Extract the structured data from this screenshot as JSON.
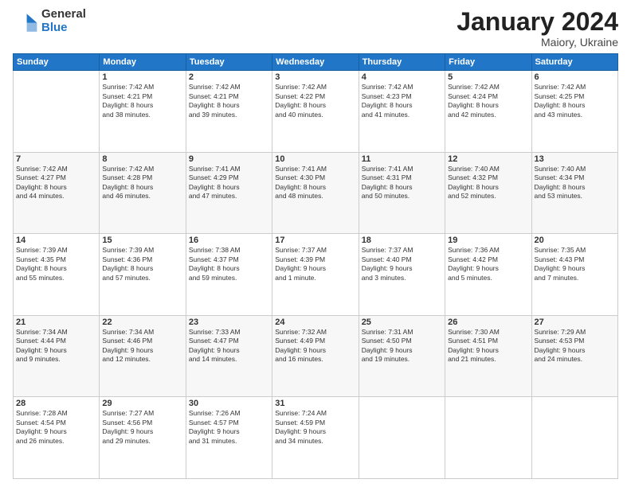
{
  "header": {
    "logo_general": "General",
    "logo_blue": "Blue",
    "month_title": "January 2024",
    "location": "Maiory, Ukraine"
  },
  "weekdays": [
    "Sunday",
    "Monday",
    "Tuesday",
    "Wednesday",
    "Thursday",
    "Friday",
    "Saturday"
  ],
  "weeks": [
    [
      {
        "day": "",
        "info": ""
      },
      {
        "day": "1",
        "info": "Sunrise: 7:42 AM\nSunset: 4:21 PM\nDaylight: 8 hours\nand 38 minutes."
      },
      {
        "day": "2",
        "info": "Sunrise: 7:42 AM\nSunset: 4:21 PM\nDaylight: 8 hours\nand 39 minutes."
      },
      {
        "day": "3",
        "info": "Sunrise: 7:42 AM\nSunset: 4:22 PM\nDaylight: 8 hours\nand 40 minutes."
      },
      {
        "day": "4",
        "info": "Sunrise: 7:42 AM\nSunset: 4:23 PM\nDaylight: 8 hours\nand 41 minutes."
      },
      {
        "day": "5",
        "info": "Sunrise: 7:42 AM\nSunset: 4:24 PM\nDaylight: 8 hours\nand 42 minutes."
      },
      {
        "day": "6",
        "info": "Sunrise: 7:42 AM\nSunset: 4:25 PM\nDaylight: 8 hours\nand 43 minutes."
      }
    ],
    [
      {
        "day": "7",
        "info": "Sunrise: 7:42 AM\nSunset: 4:27 PM\nDaylight: 8 hours\nand 44 minutes."
      },
      {
        "day": "8",
        "info": "Sunrise: 7:42 AM\nSunset: 4:28 PM\nDaylight: 8 hours\nand 46 minutes."
      },
      {
        "day": "9",
        "info": "Sunrise: 7:41 AM\nSunset: 4:29 PM\nDaylight: 8 hours\nand 47 minutes."
      },
      {
        "day": "10",
        "info": "Sunrise: 7:41 AM\nSunset: 4:30 PM\nDaylight: 8 hours\nand 48 minutes."
      },
      {
        "day": "11",
        "info": "Sunrise: 7:41 AM\nSunset: 4:31 PM\nDaylight: 8 hours\nand 50 minutes."
      },
      {
        "day": "12",
        "info": "Sunrise: 7:40 AM\nSunset: 4:32 PM\nDaylight: 8 hours\nand 52 minutes."
      },
      {
        "day": "13",
        "info": "Sunrise: 7:40 AM\nSunset: 4:34 PM\nDaylight: 8 hours\nand 53 minutes."
      }
    ],
    [
      {
        "day": "14",
        "info": "Sunrise: 7:39 AM\nSunset: 4:35 PM\nDaylight: 8 hours\nand 55 minutes."
      },
      {
        "day": "15",
        "info": "Sunrise: 7:39 AM\nSunset: 4:36 PM\nDaylight: 8 hours\nand 57 minutes."
      },
      {
        "day": "16",
        "info": "Sunrise: 7:38 AM\nSunset: 4:37 PM\nDaylight: 8 hours\nand 59 minutes."
      },
      {
        "day": "17",
        "info": "Sunrise: 7:37 AM\nSunset: 4:39 PM\nDaylight: 9 hours\nand 1 minute."
      },
      {
        "day": "18",
        "info": "Sunrise: 7:37 AM\nSunset: 4:40 PM\nDaylight: 9 hours\nand 3 minutes."
      },
      {
        "day": "19",
        "info": "Sunrise: 7:36 AM\nSunset: 4:42 PM\nDaylight: 9 hours\nand 5 minutes."
      },
      {
        "day": "20",
        "info": "Sunrise: 7:35 AM\nSunset: 4:43 PM\nDaylight: 9 hours\nand 7 minutes."
      }
    ],
    [
      {
        "day": "21",
        "info": "Sunrise: 7:34 AM\nSunset: 4:44 PM\nDaylight: 9 hours\nand 9 minutes."
      },
      {
        "day": "22",
        "info": "Sunrise: 7:34 AM\nSunset: 4:46 PM\nDaylight: 9 hours\nand 12 minutes."
      },
      {
        "day": "23",
        "info": "Sunrise: 7:33 AM\nSunset: 4:47 PM\nDaylight: 9 hours\nand 14 minutes."
      },
      {
        "day": "24",
        "info": "Sunrise: 7:32 AM\nSunset: 4:49 PM\nDaylight: 9 hours\nand 16 minutes."
      },
      {
        "day": "25",
        "info": "Sunrise: 7:31 AM\nSunset: 4:50 PM\nDaylight: 9 hours\nand 19 minutes."
      },
      {
        "day": "26",
        "info": "Sunrise: 7:30 AM\nSunset: 4:51 PM\nDaylight: 9 hours\nand 21 minutes."
      },
      {
        "day": "27",
        "info": "Sunrise: 7:29 AM\nSunset: 4:53 PM\nDaylight: 9 hours\nand 24 minutes."
      }
    ],
    [
      {
        "day": "28",
        "info": "Sunrise: 7:28 AM\nSunset: 4:54 PM\nDaylight: 9 hours\nand 26 minutes."
      },
      {
        "day": "29",
        "info": "Sunrise: 7:27 AM\nSunset: 4:56 PM\nDaylight: 9 hours\nand 29 minutes."
      },
      {
        "day": "30",
        "info": "Sunrise: 7:26 AM\nSunset: 4:57 PM\nDaylight: 9 hours\nand 31 minutes."
      },
      {
        "day": "31",
        "info": "Sunrise: 7:24 AM\nSunset: 4:59 PM\nDaylight: 9 hours\nand 34 minutes."
      },
      {
        "day": "",
        "info": ""
      },
      {
        "day": "",
        "info": ""
      },
      {
        "day": "",
        "info": ""
      }
    ]
  ]
}
